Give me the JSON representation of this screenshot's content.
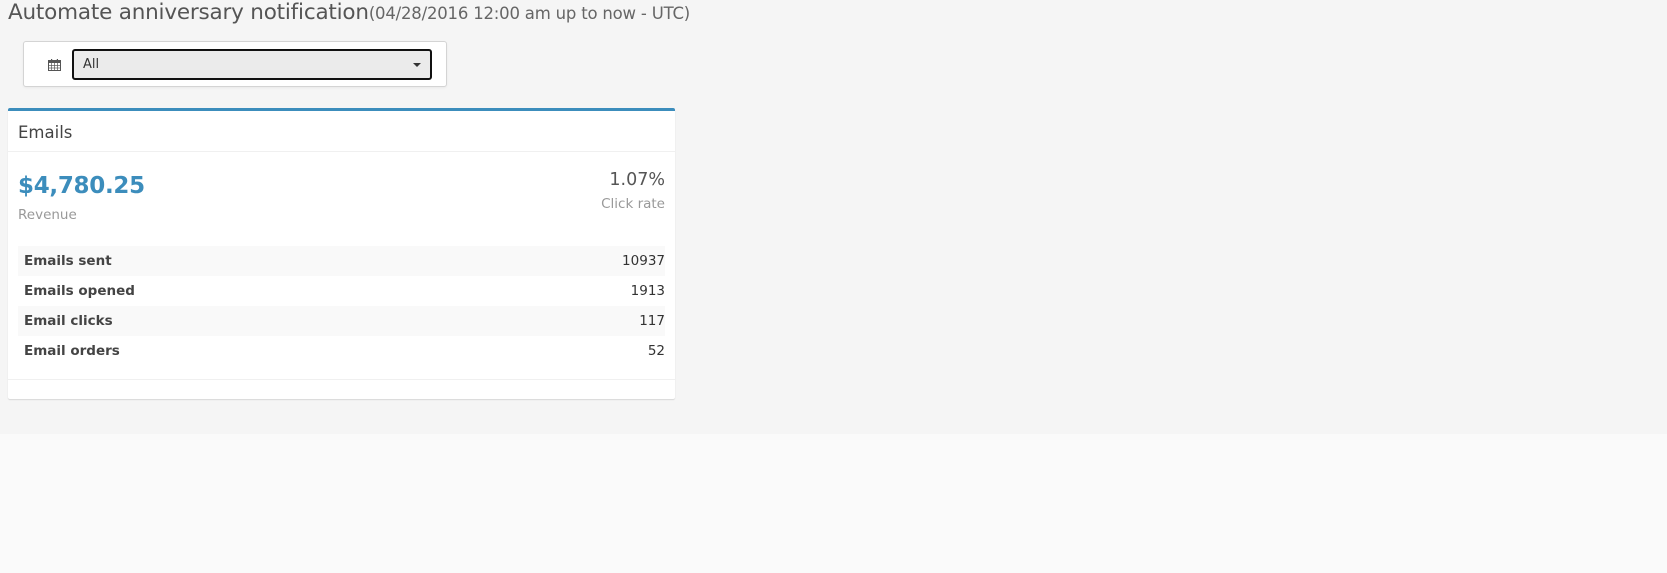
{
  "header": {
    "title": "Automate anniversary notification",
    "subtitle": "(04/28/2016 12:00 am up to now - UTC)"
  },
  "filter": {
    "icon": "calendar-icon",
    "selected": "All"
  },
  "panel": {
    "title": "Emails",
    "revenue": {
      "value": "$4,780.25",
      "label": "Revenue"
    },
    "click_rate": {
      "value": "1.07%",
      "label": "Click rate"
    },
    "stats": [
      {
        "label": "Emails sent",
        "value": "10937"
      },
      {
        "label": "Emails opened",
        "value": "1913"
      },
      {
        "label": "Email clicks",
        "value": "117"
      },
      {
        "label": "Email orders",
        "value": "52"
      }
    ]
  },
  "colors": {
    "accent": "#3c8dbc",
    "background": "#f5f5f5"
  }
}
